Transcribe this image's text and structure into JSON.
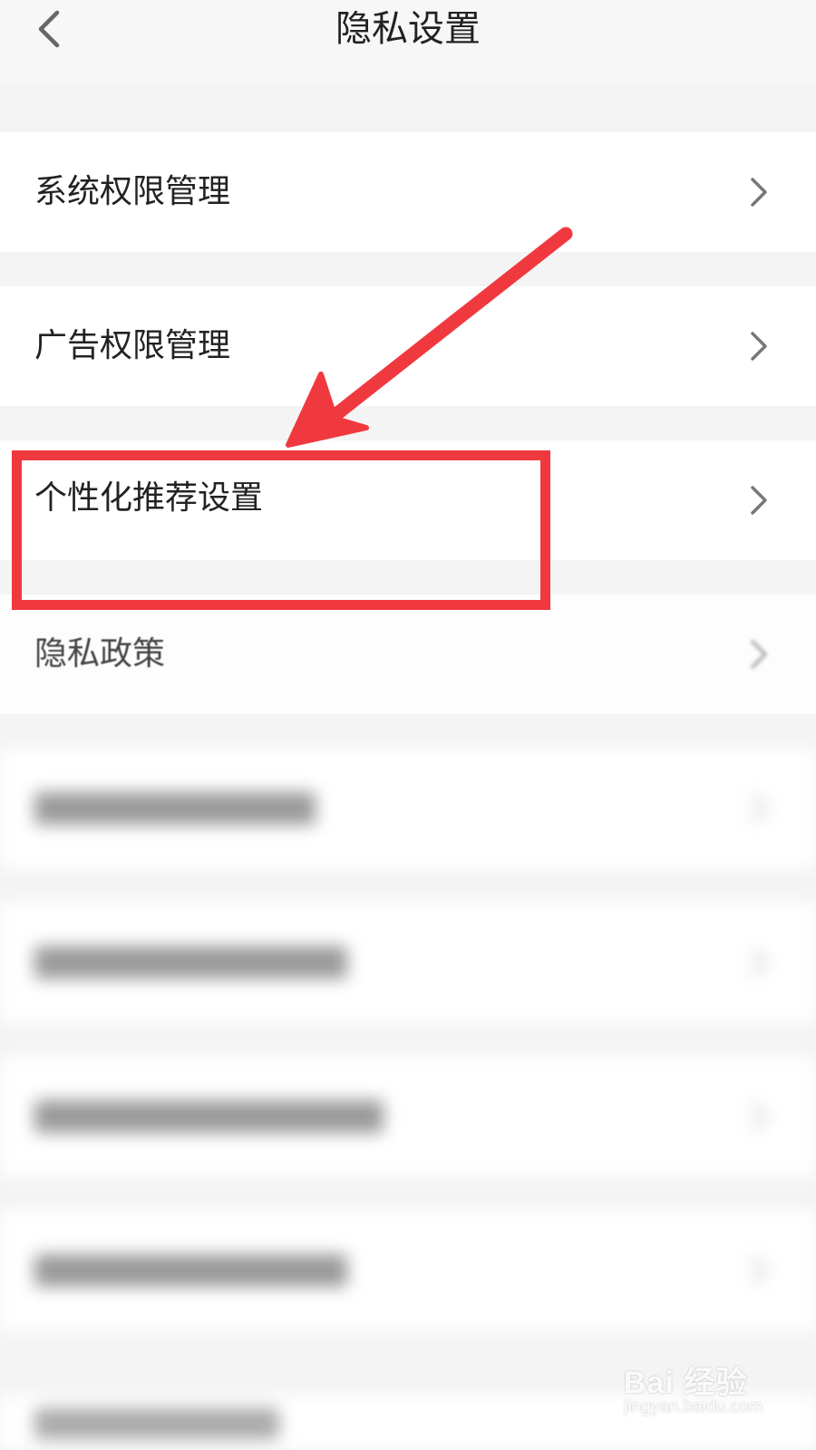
{
  "header": {
    "title": "隐私设置",
    "back_icon": "chevron-left-icon"
  },
  "settings": [
    {
      "label": "系统权限管理",
      "blurred": false
    },
    {
      "label": "广告权限管理",
      "blurred": false
    },
    {
      "label": "个性化推荐设置",
      "blurred": false,
      "highlighted": true
    },
    {
      "label": "隐私政策",
      "blurred": false
    },
    {
      "label": "",
      "blurred": true
    },
    {
      "label": "",
      "blurred": true
    },
    {
      "label": "",
      "blurred": true
    },
    {
      "label": "",
      "blurred": true
    }
  ],
  "annotation": {
    "color": "#f0393f"
  },
  "watermark": {
    "brand": "Bai 经验",
    "url": "jingyan.baidu.com"
  }
}
